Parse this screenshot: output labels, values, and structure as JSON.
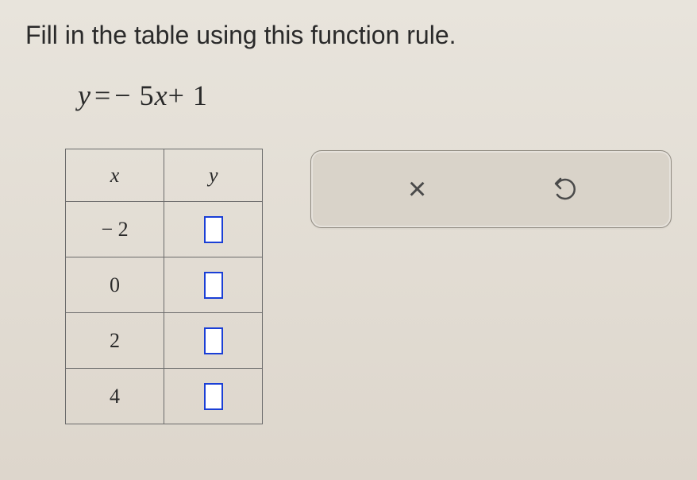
{
  "instruction": "Fill in the table using this function rule.",
  "equation": {
    "lhs": "y",
    "rhs_prefix": "− 5",
    "rhs_var": "x",
    "rhs_suffix": "+ 1"
  },
  "table": {
    "headers": {
      "x": "x",
      "y": "y"
    },
    "rows": [
      {
        "x": "− 2"
      },
      {
        "x": "0"
      },
      {
        "x": "2"
      },
      {
        "x": "4"
      }
    ]
  },
  "toolbar": {
    "close_label": "×",
    "undo_label": "↶"
  }
}
